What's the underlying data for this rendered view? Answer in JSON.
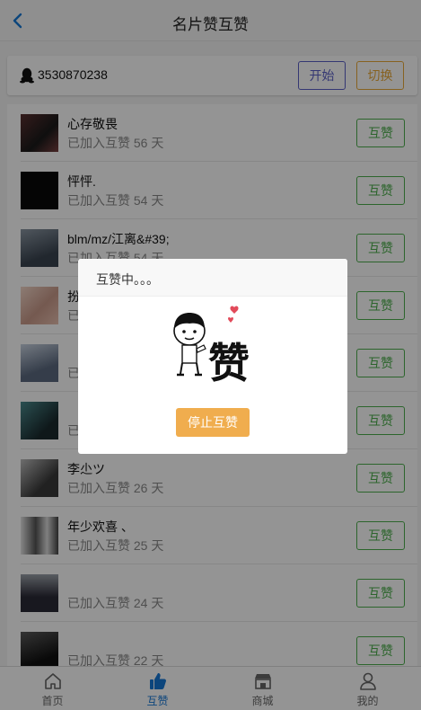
{
  "header": {
    "title": "名片赞互赞"
  },
  "qq": {
    "number": "3530870238",
    "start_label": "开始",
    "switch_label": "切换"
  },
  "list": [
    {
      "name": "心存敬畏",
      "days": "已加入互赞 56 天",
      "button": "互赞",
      "avatar_color": "#3b2b2b"
    },
    {
      "name": "怦怦.",
      "days": "已加入互赞 54 天",
      "button": "互赞",
      "avatar_color": "#0a0a0a"
    },
    {
      "name": "blm/mz/江离&#39;",
      "days": "已加入互赞 54 天",
      "button": "互赞",
      "avatar_color": "#5a6470"
    },
    {
      "name": "扮",
      "days": "已",
      "button": "互赞",
      "avatar_color": "#d9b8a8"
    },
    {
      "name": "",
      "days": "已",
      "button": "互赞",
      "avatar_color": "#8d9bb0"
    },
    {
      "name": "",
      "days": "已",
      "button": "互赞",
      "avatar_color": "#2f5b5e"
    },
    {
      "name": "李尐ツ",
      "days": "已加入互赞 26 天",
      "button": "互赞",
      "avatar_color": "#6b6b6b"
    },
    {
      "name": "年少欢喜 、",
      "days": "已加入互赞 25 天",
      "button": "互赞",
      "avatar_color": "#9a9a9a"
    },
    {
      "name": "",
      "days": "已加入互赞 24 天",
      "button": "互赞",
      "avatar_color": "#3a3a44"
    },
    {
      "name": "",
      "days": "已加入互赞 22 天",
      "button": "互赞",
      "avatar_color": "#2a2a2a"
    }
  ],
  "tabs": [
    {
      "label": "首页",
      "icon": "home-icon",
      "active": false
    },
    {
      "label": "互赞",
      "icon": "thumbs-up-icon",
      "active": true
    },
    {
      "label": "商城",
      "icon": "shop-icon",
      "active": false
    },
    {
      "label": "我的",
      "icon": "user-icon",
      "active": false
    }
  ],
  "modal": {
    "title": "互赞中。。。",
    "stop_label": "停止互赞",
    "sticker_text": "赞"
  },
  "colors": {
    "accent_blue": "#1677d6",
    "green": "#4cae4c",
    "purple": "#5b5fc7",
    "orange": "#f0ad4e"
  }
}
